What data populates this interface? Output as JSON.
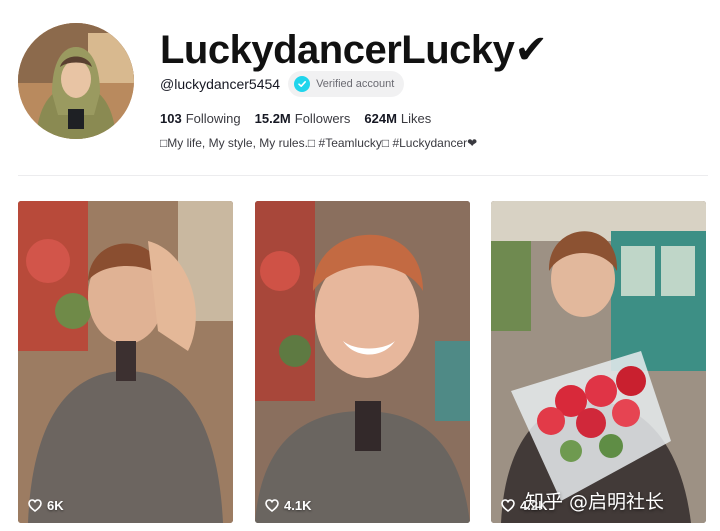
{
  "profile": {
    "display_name": "LuckydancerLucky✔",
    "username": "@luckydancer5454",
    "verified_label": "Verified account",
    "stats": [
      {
        "value": "103",
        "label": "Following"
      },
      {
        "value": "15.2M",
        "label": "Followers"
      },
      {
        "value": "624M",
        "label": "Likes"
      }
    ],
    "bio": "□My life, My style, My rules.□ #Teamlucky□ #Luckydancer❤"
  },
  "videos": [
    {
      "likes": "6K",
      "icon": "heart-outline-icon"
    },
    {
      "likes": "4.1K",
      "icon": "heart-outline-icon"
    },
    {
      "likes": "4.2K",
      "icon": "heart-outline-icon"
    }
  ],
  "watermark": "知乎 @启明社长",
  "colors": {
    "verified_accent": "#20d5ec",
    "text_primary": "#161823",
    "badge_bg": "#f1f1f2"
  }
}
